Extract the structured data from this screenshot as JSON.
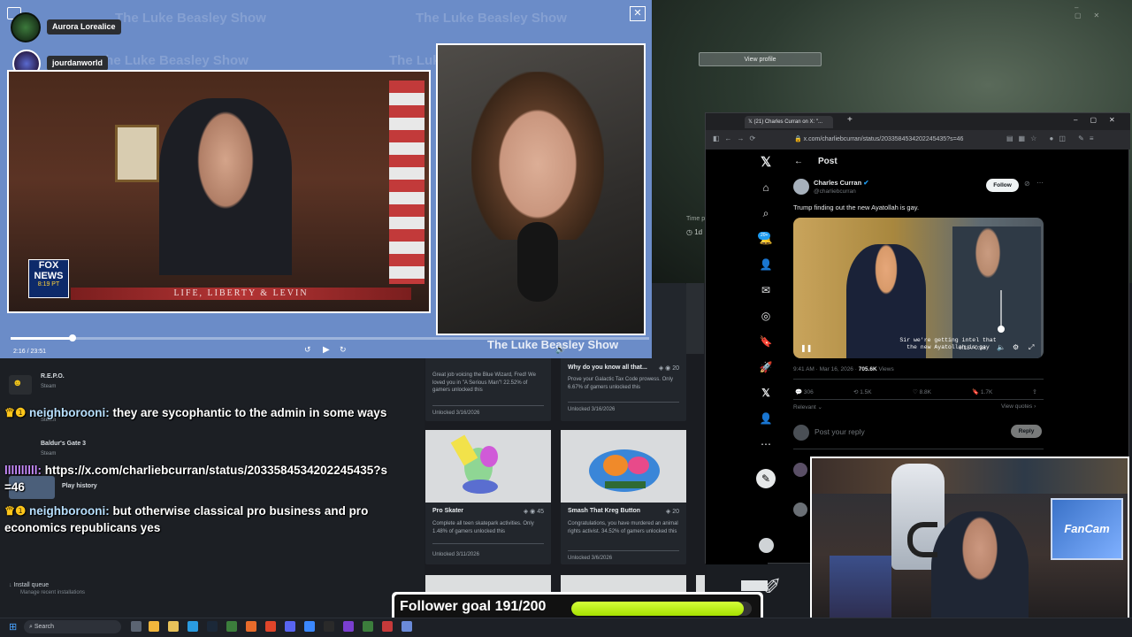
{
  "popup": {
    "watermark": "The Luke Beasley Show",
    "participant_1": "Aurora Lorealice",
    "participant_2": "jourdanworld",
    "fox_logo_1": "FOX",
    "fox_logo_2": "NEWS",
    "fox_time": "8:19 PT",
    "banner": "LIFE, LIBERTY & LEVIN",
    "show_logo": "The Luke Beasley Show",
    "time": "2:16 / 23:51",
    "progress": 0.097
  },
  "steam": {
    "items": [
      {
        "name": "R.E.P.O.",
        "sub": "Steam"
      },
      {
        "name": "",
        "sub": "Steam"
      },
      {
        "name": "Baldur's Gate 3",
        "sub": "Steam"
      },
      {
        "name": "Play history",
        "sub": ""
      }
    ],
    "install_queue": "Install queue",
    "install_sub": "Manage recent installations",
    "view_profile": "View profile",
    "time_label": "Time p",
    "time_value": "1d"
  },
  "cards": [
    {
      "title": "",
      "pts": "",
      "desc": "Great job voicing the Blue Wizard, Fred! We loved you in \"A Serious Man\"! 22.52% of gamers unlocked this",
      "unlocked": "Unlocked 3/16/2026"
    },
    {
      "title": "Why do you know all that...",
      "pts": "20",
      "desc": "Prove your Galactic Tax Code prowess. Only 6.67% of gamers unlocked this",
      "unlocked": "Unlocked 3/16/2026"
    },
    {
      "title": "Pro Skater",
      "pts": "45",
      "desc": "Complete all teen skatepark activities. Only 1.48% of gamers unlocked this",
      "unlocked": "Unlocked 3/11/2026"
    },
    {
      "title": "Smash That Kreg Button",
      "pts": "20",
      "desc": "Congratulations, you have murdered an animal rights activist. 34.52% of gamers unlocked this",
      "unlocked": "Unlocked 3/6/2026"
    }
  ],
  "chat": {
    "line1_user": "neighborooni:",
    "line1_text": "they are sycophantic to the admin in some ways",
    "line2_user": "llllllllll:",
    "line2_text": "https://x.com/charliebcurran/status/2033584534202245435?s=46",
    "line3_user": "neighborooni:",
    "line3_text": "but otherwise classical pro business and pro economics republicans yes"
  },
  "browser": {
    "tab_title": "(21) Charles Curran on X: \"...",
    "url": "x.com/charliebcurran/status/2033584534202245435?s=46",
    "header": "Post",
    "author": "Charles Curran",
    "handle": "@charliebcurran",
    "follow": "Follow",
    "post_text": "Trump finding out the new Ayatollah is gay.",
    "caption_1": "Sir we're getting intel that",
    "caption_2": "the new Ayatollah is gay",
    "video_time": "0:18 / 0:33",
    "meta_date": "9:41 AM · Mar 16, 2026 ·",
    "views": "705.6K",
    "views_label": "Views",
    "replies": "306",
    "reposts": "1.5K",
    "likes": "8.8K",
    "bookmarks": "1.7K",
    "relevant": "Relevant",
    "view_quotes": "View quotes",
    "reply_placeholder": "Post your reply",
    "reply_button": "Reply",
    "badge": "20+"
  },
  "goal": {
    "label": "Follower goal 191/200",
    "progress": 0.955
  },
  "taskbar": {
    "search": "Search"
  },
  "webcam": {
    "sign": "FanCam"
  }
}
